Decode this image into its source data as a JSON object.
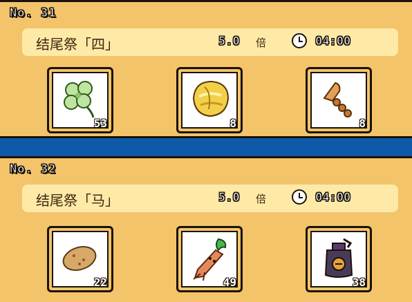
{
  "orders": [
    {
      "number": "No. 31",
      "title": "结尾祭「四」",
      "multiplier": "5.0",
      "multiplier_unit": "倍",
      "timer": "04:00",
      "items": [
        {
          "icon": "clover-icon",
          "count": "53"
        },
        {
          "icon": "golden-leaf-icon",
          "count": "8"
        },
        {
          "icon": "wooden-horn-icon",
          "count": "8"
        }
      ]
    },
    {
      "number": "No. 32",
      "title": "结尾祭「马」",
      "multiplier": "5.0",
      "multiplier_unit": "倍",
      "timer": "04:00",
      "items": [
        {
          "icon": "potato-icon",
          "count": "22"
        },
        {
          "icon": "mandrake-root-icon",
          "count": "49"
        },
        {
          "icon": "potion-bottle-icon",
          "count": "38"
        }
      ]
    }
  ],
  "colors": {
    "background": "#0e5aa8",
    "panel": "#f3c46a",
    "info_bar": "#ffe9a6",
    "outline": "#1a1208"
  }
}
